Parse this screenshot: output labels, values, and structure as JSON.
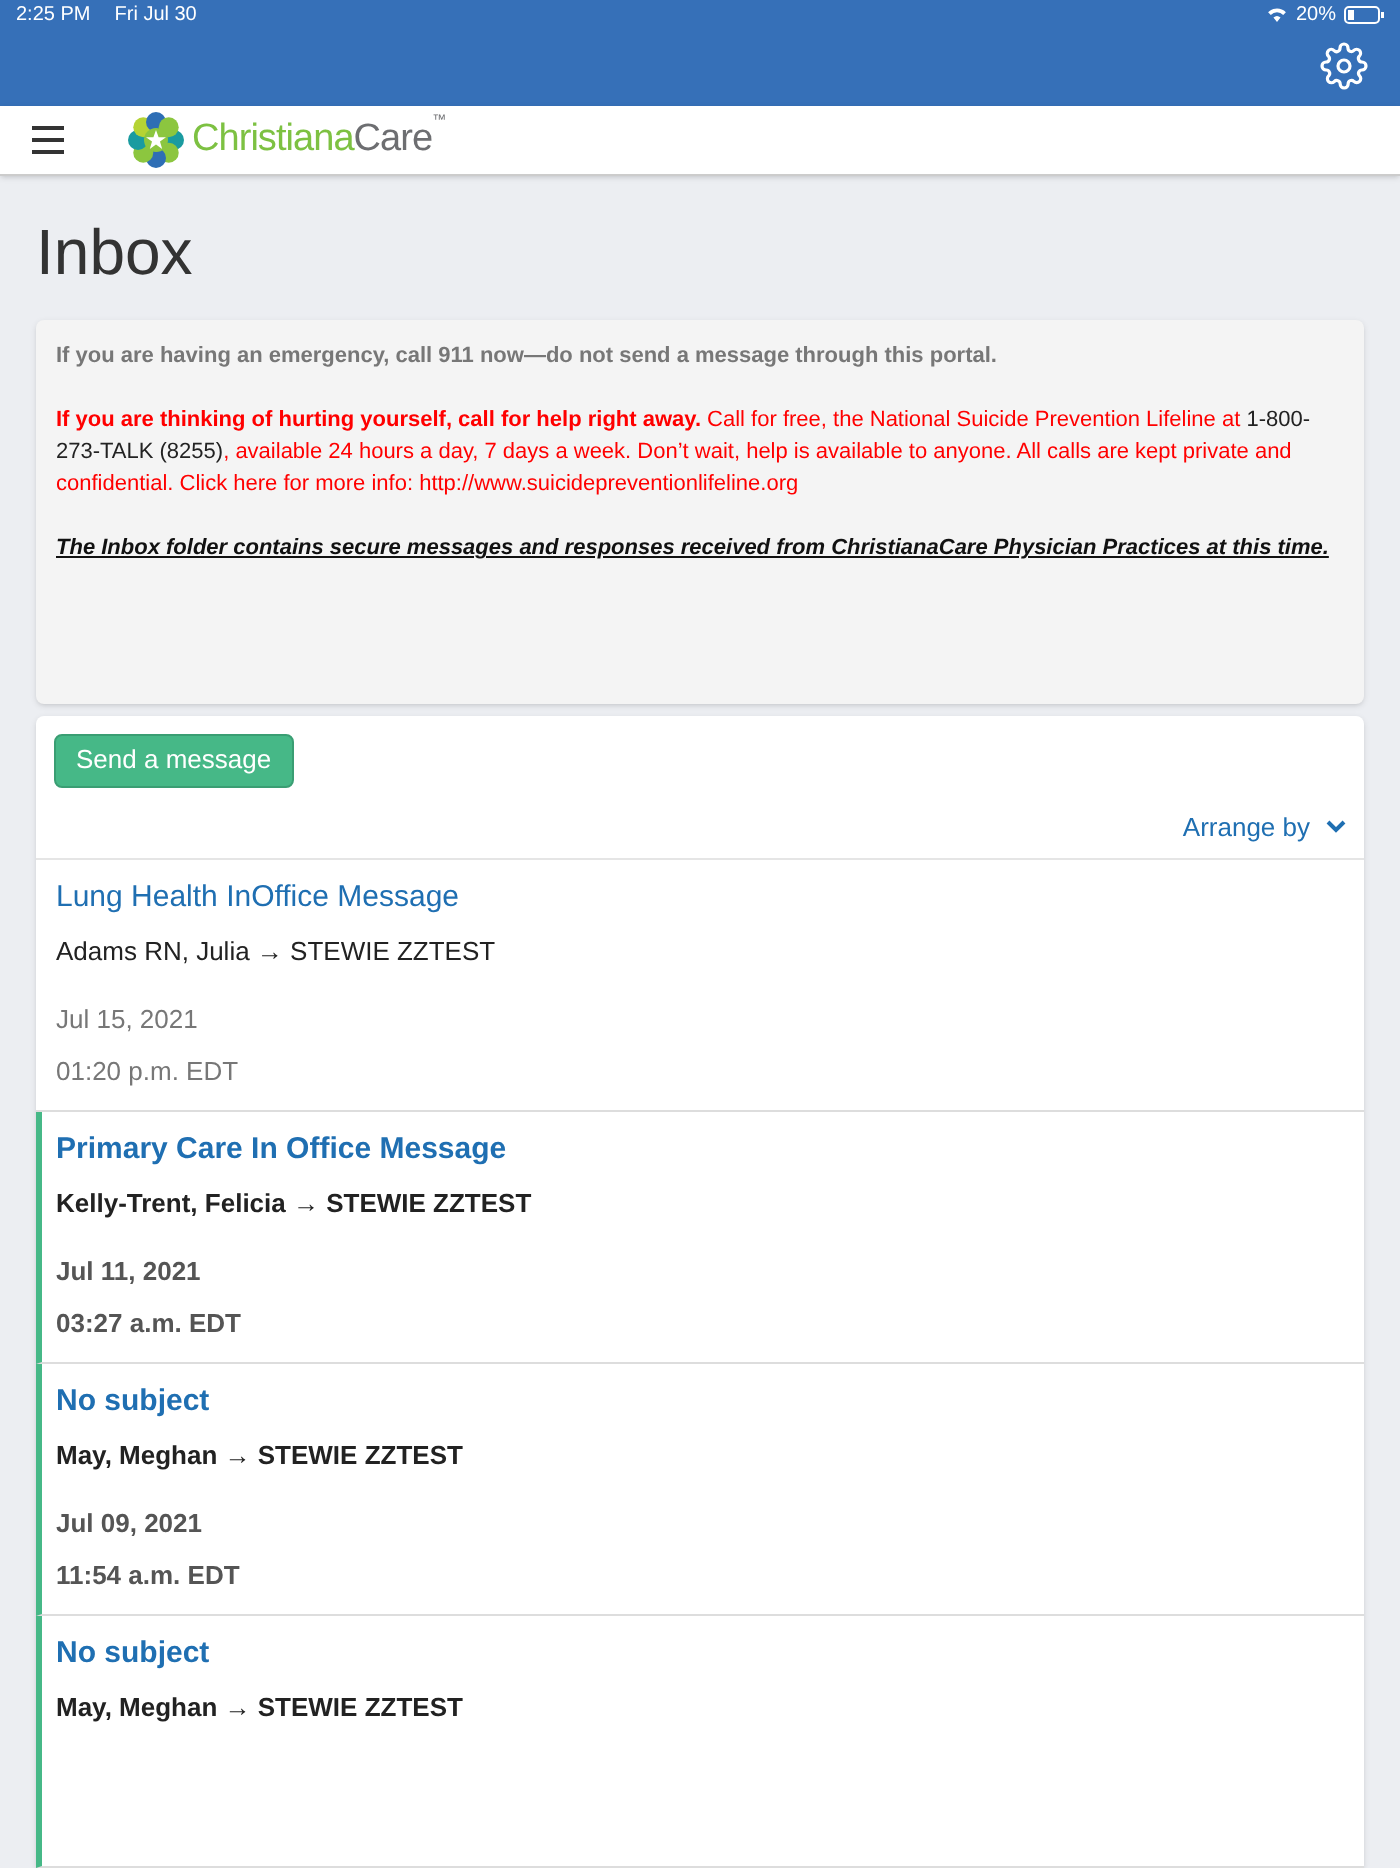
{
  "status_bar": {
    "time": "2:25 PM",
    "date": "Fri Jul 30",
    "battery": "20%"
  },
  "nav": {
    "logo_first": "Christiana",
    "logo_second": "Care",
    "logo_mark": "™"
  },
  "page_title": "Inbox",
  "notice": {
    "emergency": "If you are having an emergency, call 911 now—do not send a message through this portal.",
    "crisis": [
      {
        "kind": "bold",
        "text": "If you are thinking of hurting yourself, call for help right away."
      },
      {
        "kind": "plain",
        "text": " Call for free, the National Suicide Prevention Lifeline at "
      },
      {
        "kind": "phone",
        "text": "1-800-273-TALK (8255)"
      },
      {
        "kind": "plain",
        "text": ", available 24 hours a day, 7 days a week. Don’t wait, help is available to anyone. All calls are kept private and confidential. Click here for more info: http://www.suicidepreventionlifeline.org"
      }
    ],
    "folder_note": "The Inbox folder contains secure messages and responses received from ChristianaCare Physician Practices at this time."
  },
  "send_button": "Send a message",
  "arrange_by": "Arrange by",
  "messages": [
    {
      "subject": "Lung Health InOffice Message",
      "from_to": "Adams RN, Julia → STEWIE ZZTEST",
      "date": "Jul 15, 2021",
      "time": "01:20 p.m. EDT",
      "unread": false
    },
    {
      "subject": "Primary Care In Office Message",
      "from_to": "Kelly-Trent, Felicia → STEWIE ZZTEST",
      "date": "Jul 11, 2021",
      "time": "03:27 a.m. EDT",
      "unread": true
    },
    {
      "subject": "No subject",
      "from_to": "May, Meghan → STEWIE ZZTEST",
      "date": "Jul 09, 2021",
      "time": "11:54 a.m. EDT",
      "unread": true
    },
    {
      "subject": "No subject",
      "from_to": "May, Meghan → STEWIE ZZTEST",
      "unread": true
    }
  ]
}
